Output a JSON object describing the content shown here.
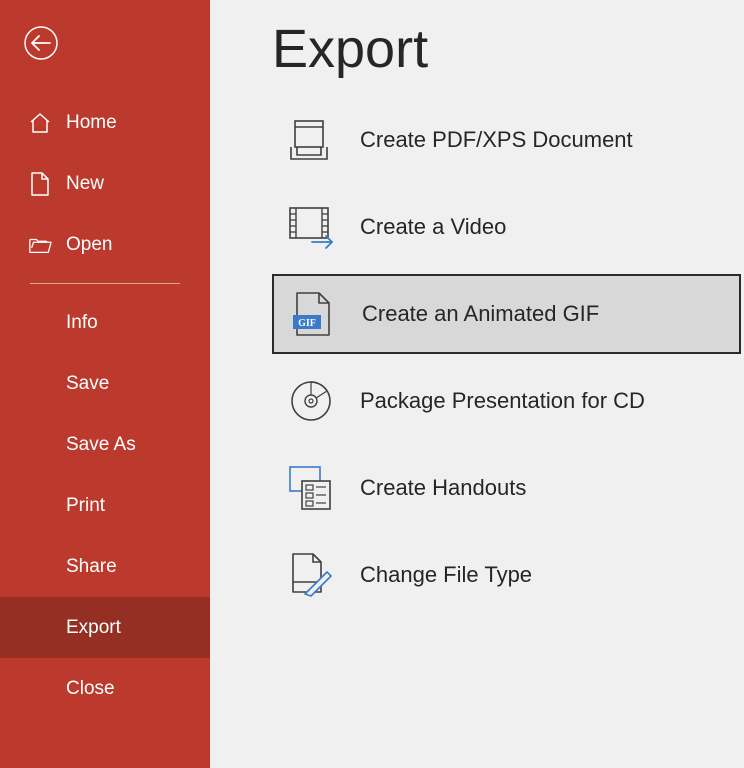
{
  "sidebar": {
    "items": [
      {
        "label": "Home"
      },
      {
        "label": "New"
      },
      {
        "label": "Open"
      },
      {
        "label": "Info"
      },
      {
        "label": "Save"
      },
      {
        "label": "Save As"
      },
      {
        "label": "Print"
      },
      {
        "label": "Share"
      },
      {
        "label": "Export"
      },
      {
        "label": "Close"
      }
    ]
  },
  "main": {
    "title": "Export",
    "options": [
      {
        "label": "Create PDF/XPS Document"
      },
      {
        "label": "Create a Video"
      },
      {
        "label": "Create an Animated GIF"
      },
      {
        "label": "Package Presentation for CD"
      },
      {
        "label": "Create Handouts"
      },
      {
        "label": "Change File Type"
      }
    ]
  }
}
